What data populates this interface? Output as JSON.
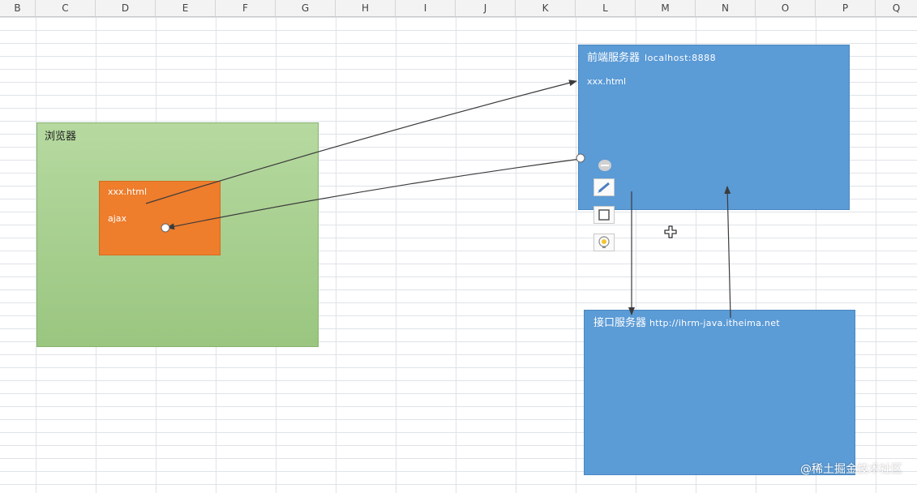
{
  "sheet": {
    "columns": [
      "B",
      "C",
      "D",
      "E",
      "F",
      "G",
      "H",
      "I",
      "J",
      "K",
      "L",
      "M",
      "N",
      "O",
      "P",
      "Q"
    ]
  },
  "diagram": {
    "browser": {
      "label": "浏览器"
    },
    "page": {
      "file": "xxx.html",
      "ajax": "ajax"
    },
    "frontend_server": {
      "label": "前端服务器",
      "host": "localhost:8888",
      "file": "xxx.html"
    },
    "api_server": {
      "label": "接口服务器",
      "url": "http://ihrm-java.itheima.net"
    }
  },
  "toolbar": {
    "icons": [
      "collapse-icon",
      "style-brush-icon",
      "shape-outline-icon",
      "idea-bulb-icon"
    ]
  },
  "watermark": "@稀土掘金技术社区",
  "colors": {
    "browser_fill": "#a9d18e",
    "page_fill": "#ee7d2c",
    "server_fill": "#5b9bd6"
  }
}
